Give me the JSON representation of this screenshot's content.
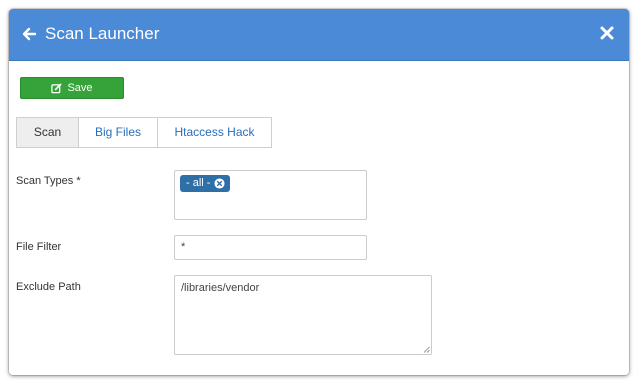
{
  "dialog": {
    "title": "Scan Launcher",
    "back_icon": "arrow-left-icon",
    "close_icon": "close-icon"
  },
  "toolbar": {
    "save_label": "Save",
    "save_icon": "edit-square-icon"
  },
  "tabs": [
    {
      "label": "Scan",
      "active": true
    },
    {
      "label": "Big Files",
      "active": false
    },
    {
      "label": "Htaccess Hack",
      "active": false
    }
  ],
  "form": {
    "scan_types": {
      "label": "Scan Types *",
      "selected": [
        "- all -"
      ]
    },
    "file_filter": {
      "label": "File Filter",
      "value": "*"
    },
    "exclude_path": {
      "label": "Exclude Path",
      "value": "/libraries/vendor"
    }
  },
  "colors": {
    "header": "#4a8ad6",
    "save_button": "#36a33a",
    "tag": "#2f6fa8",
    "link": "#2a6ebb"
  }
}
